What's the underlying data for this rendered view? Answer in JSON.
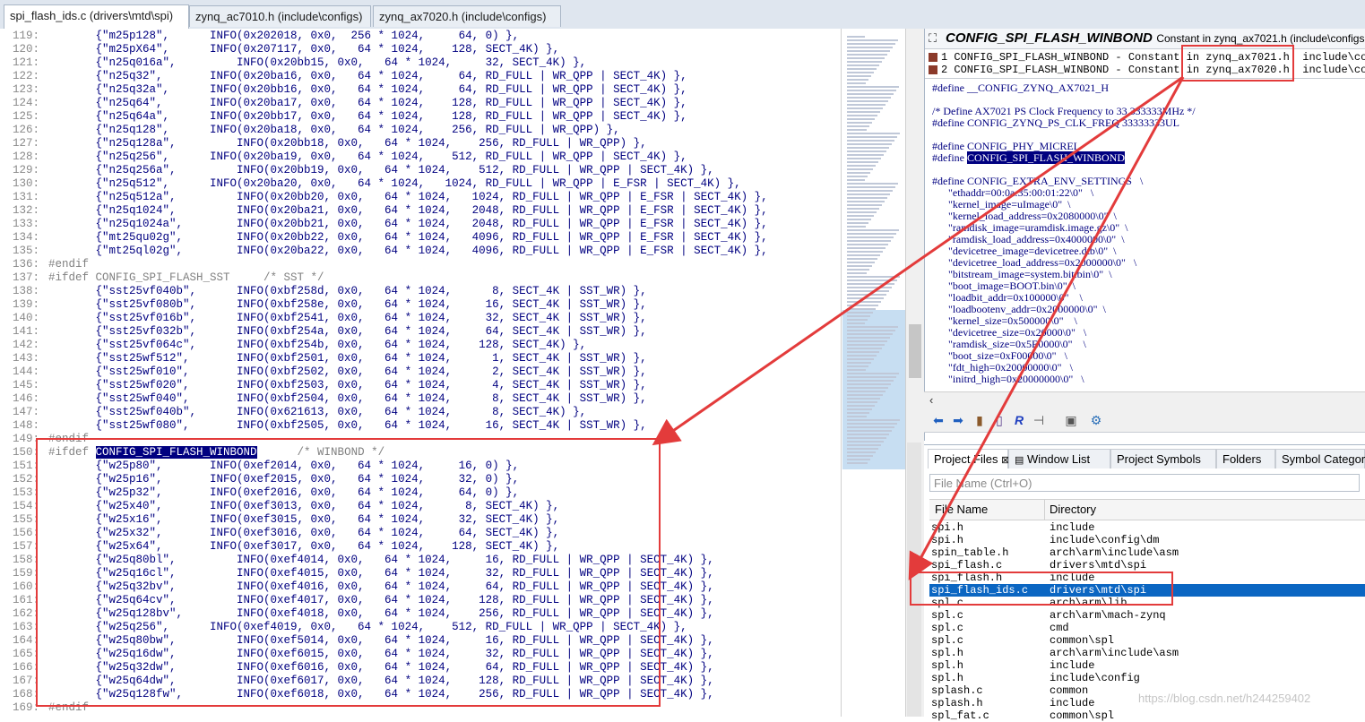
{
  "tabs": [
    {
      "label": "spi_flash_ids.c (drivers\\mtd\\spi)",
      "close": "⊠",
      "active": true
    },
    {
      "label": "zynq_ac7010.h (include\\configs)",
      "active": false
    },
    {
      "label": "zynq_ax7020.h (include\\configs)",
      "active": false
    }
  ],
  "code_lines": [
    {
      "n": "119:",
      "t": "       {\"m25p128\",      INFO(0x202018, 0x0,  256 * 1024,     64, 0) },"
    },
    {
      "n": "120:",
      "t": "       {\"m25pX64\",      INFO(0x207117, 0x0,   64 * 1024,    128, SECT_4K) },"
    },
    {
      "n": "121:",
      "t": "       {\"n25q016a\",         INFO(0x20bb15, 0x0,   64 * 1024,     32, SECT_4K) },"
    },
    {
      "n": "122:",
      "t": "       {\"n25q32\",       INFO(0x20ba16, 0x0,   64 * 1024,     64, RD_FULL | WR_QPP | SECT_4K) },"
    },
    {
      "n": "123:",
      "t": "       {\"n25q32a\",      INFO(0x20bb16, 0x0,   64 * 1024,     64, RD_FULL | WR_QPP | SECT_4K) },"
    },
    {
      "n": "124:",
      "t": "       {\"n25q64\",       INFO(0x20ba17, 0x0,   64 * 1024,    128, RD_FULL | WR_QPP | SECT_4K) },"
    },
    {
      "n": "125:",
      "t": "       {\"n25q64a\",      INFO(0x20bb17, 0x0,   64 * 1024,    128, RD_FULL | WR_QPP | SECT_4K) },"
    },
    {
      "n": "126:",
      "t": "       {\"n25q128\",      INFO(0x20ba18, 0x0,   64 * 1024,    256, RD_FULL | WR_QPP) },"
    },
    {
      "n": "127:",
      "t": "       {\"n25q128a\",         INFO(0x20bb18, 0x0,   64 * 1024,    256, RD_FULL | WR_QPP) },"
    },
    {
      "n": "128:",
      "t": "       {\"n25q256\",      INFO(0x20ba19, 0x0,   64 * 1024,    512, RD_FULL | WR_QPP | SECT_4K) },"
    },
    {
      "n": "129:",
      "t": "       {\"n25q256a\",         INFO(0x20bb19, 0x0,   64 * 1024,    512, RD_FULL | WR_QPP | SECT_4K) },"
    },
    {
      "n": "130:",
      "t": "       {\"n25q512\",      INFO(0x20ba20, 0x0,   64 * 1024,   1024, RD_FULL | WR_QPP | E_FSR | SECT_4K) },"
    },
    {
      "n": "131:",
      "t": "       {\"n25q512a\",         INFO(0x20bb20, 0x0,   64 * 1024,   1024, RD_FULL | WR_QPP | E_FSR | SECT_4K) },"
    },
    {
      "n": "132:",
      "t": "       {\"n25q1024\",         INFO(0x20ba21, 0x0,   64 * 1024,   2048, RD_FULL | WR_QPP | E_FSR | SECT_4K) },"
    },
    {
      "n": "133:",
      "t": "       {\"n25q1024a\",        INFO(0x20bb21, 0x0,   64 * 1024,   2048, RD_FULL | WR_QPP | E_FSR | SECT_4K) },"
    },
    {
      "n": "134:",
      "t": "       {\"mt25qu02g\",        INFO(0x20bb22, 0x0,   64 * 1024,   4096, RD_FULL | WR_QPP | E_FSR | SECT_4K) },"
    },
    {
      "n": "135:",
      "t": "       {\"mt25ql02g\",        INFO(0x20ba22, 0x0,   64 * 1024,   4096, RD_FULL | WR_QPP | E_FSR | SECT_4K) },"
    },
    {
      "n": "136:",
      "t": "#endif"
    },
    {
      "n": "137:",
      "t": "#ifdef CONFIG_SPI_FLASH_SST     /* SST */"
    },
    {
      "n": "138:",
      "t": "       {\"sst25vf040b\",      INFO(0xbf258d, 0x0,   64 * 1024,      8, SECT_4K | SST_WR) },"
    },
    {
      "n": "139:",
      "t": "       {\"sst25vf080b\",      INFO(0xbf258e, 0x0,   64 * 1024,     16, SECT_4K | SST_WR) },"
    },
    {
      "n": "140:",
      "t": "       {\"sst25vf016b\",      INFO(0xbf2541, 0x0,   64 * 1024,     32, SECT_4K | SST_WR) },"
    },
    {
      "n": "141:",
      "t": "       {\"sst25vf032b\",      INFO(0xbf254a, 0x0,   64 * 1024,     64, SECT_4K | SST_WR) },"
    },
    {
      "n": "142:",
      "t": "       {\"sst25vf064c\",      INFO(0xbf254b, 0x0,   64 * 1024,    128, SECT_4K) },"
    },
    {
      "n": "143:",
      "t": "       {\"sst25wf512\",       INFO(0xbf2501, 0x0,   64 * 1024,      1, SECT_4K | SST_WR) },"
    },
    {
      "n": "144:",
      "t": "       {\"sst25wf010\",       INFO(0xbf2502, 0x0,   64 * 1024,      2, SECT_4K | SST_WR) },"
    },
    {
      "n": "145:",
      "t": "       {\"sst25wf020\",       INFO(0xbf2503, 0x0,   64 * 1024,      4, SECT_4K | SST_WR) },"
    },
    {
      "n": "146:",
      "t": "       {\"sst25wf040\",       INFO(0xbf2504, 0x0,   64 * 1024,      8, SECT_4K | SST_WR) },"
    },
    {
      "n": "147:",
      "t": "       {\"sst25wf040b\",      INFO(0x621613, 0x0,   64 * 1024,      8, SECT_4K) },"
    },
    {
      "n": "148:",
      "t": "       {\"sst25wf080\",       INFO(0xbf2505, 0x0,   64 * 1024,     16, SECT_4K | SST_WR) },"
    },
    {
      "n": "149:",
      "t": "#endif"
    },
    {
      "n": "150:",
      "t": "#ifdef CONFIG_SPI_FLASH_WINBOND      /* WINBOND */",
      "sel": "CONFIG_SPI_FLASH_WINBOND"
    },
    {
      "n": "151:",
      "t": "       {\"w25p80\",       INFO(0xef2014, 0x0,   64 * 1024,     16, 0) },"
    },
    {
      "n": "152:",
      "t": "       {\"w25p16\",       INFO(0xef2015, 0x0,   64 * 1024,     32, 0) },"
    },
    {
      "n": "153:",
      "t": "       {\"w25p32\",       INFO(0xef2016, 0x0,   64 * 1024,     64, 0) },"
    },
    {
      "n": "154:",
      "t": "       {\"w25x40\",       INFO(0xef3013, 0x0,   64 * 1024,      8, SECT_4K) },"
    },
    {
      "n": "155:",
      "t": "       {\"w25x16\",       INFO(0xef3015, 0x0,   64 * 1024,     32, SECT_4K) },"
    },
    {
      "n": "156:",
      "t": "       {\"w25x32\",       INFO(0xef3016, 0x0,   64 * 1024,     64, SECT_4K) },"
    },
    {
      "n": "157:",
      "t": "       {\"w25x64\",       INFO(0xef3017, 0x0,   64 * 1024,    128, SECT_4K) },"
    },
    {
      "n": "158:",
      "t": "       {\"w25q80bl\",         INFO(0xef4014, 0x0,   64 * 1024,     16, RD_FULL | WR_QPP | SECT_4K) },"
    },
    {
      "n": "159:",
      "t": "       {\"w25q16cl\",         INFO(0xef4015, 0x0,   64 * 1024,     32, RD_FULL | WR_QPP | SECT_4K) },"
    },
    {
      "n": "160:",
      "t": "       {\"w25q32bv\",         INFO(0xef4016, 0x0,   64 * 1024,     64, RD_FULL | WR_QPP | SECT_4K) },"
    },
    {
      "n": "161:",
      "t": "       {\"w25q64cv\",         INFO(0xef4017, 0x0,   64 * 1024,    128, RD_FULL | WR_QPP | SECT_4K) },"
    },
    {
      "n": "162:",
      "t": "       {\"w25q128bv\",        INFO(0xef4018, 0x0,   64 * 1024,    256, RD_FULL | WR_QPP | SECT_4K) },"
    },
    {
      "n": "163:",
      "t": "       {\"w25q256\",      INFO(0xef4019, 0x0,   64 * 1024,    512, RD_FULL | WR_QPP | SECT_4K) },"
    },
    {
      "n": "164:",
      "t": "       {\"w25q80bw\",         INFO(0xef5014, 0x0,   64 * 1024,     16, RD_FULL | WR_QPP | SECT_4K) },"
    },
    {
      "n": "165:",
      "t": "       {\"w25q16dw\",         INFO(0xef6015, 0x0,   64 * 1024,     32, RD_FULL | WR_QPP | SECT_4K) },"
    },
    {
      "n": "166:",
      "t": "       {\"w25q32dw\",         INFO(0xef6016, 0x0,   64 * 1024,     64, RD_FULL | WR_QPP | SECT_4K) },"
    },
    {
      "n": "167:",
      "t": "       {\"w25q64dw\",         INFO(0xef6017, 0x0,   64 * 1024,    128, RD_FULL | WR_QPP | SECT_4K) },"
    },
    {
      "n": "168:",
      "t": "       {\"w25q128fw\",        INFO(0xef6018, 0x0,   64 * 1024,    256, RD_FULL | WR_QPP | SECT_4K) },"
    },
    {
      "n": "169:",
      "t": "#endif"
    }
  ],
  "symbol": {
    "title": "CONFIG_SPI_FLASH_WINBOND",
    "subtitle": "Constant in zynq_ax7021.h (include\\configs",
    "defs": [
      {
        "n": "1",
        "text": "CONFIG_SPI_FLASH_WINBOND - Constant in zynq_ax7021.h  include\\con"
      },
      {
        "n": "2",
        "text": "CONFIG_SPI_FLASH_WINBOND - Constant in zynq_ax7020.h  include\\con"
      }
    ],
    "source": [
      "#define __CONFIG_ZYNQ_AX7021_H",
      "",
      "/* Define AX7021 PS Clock Frequency to 33.333333MHz */",
      "#define CONFIG_ZYNQ_PS_CLK_FREQ 33333333UL",
      "",
      "#define CONFIG_PHY_MICREL",
      "#define CONFIG_SPI_FLASH_WINBOND",
      "",
      "#define CONFIG_EXTRA_ENV_SETTINGS   \\",
      "      \"ethaddr=00:0a:35:00:01:22\\0\"   \\",
      "      \"kernel_image=uImage\\0\"  \\",
      "      \"kernel_load_address=0x2080000\\0\"  \\",
      "      \"ramdisk_image=uramdisk.image.gz\\0\"  \\",
      "      \"ramdisk_load_address=0x4000000\\0\"  \\",
      "      \"devicetree_image=devicetree.dtb\\0\"  \\",
      "      \"devicetree_load_address=0x2000000\\0\"   \\",
      "      \"bitstream_image=system.bit.bin\\0\"  \\",
      "      \"boot_image=BOOT.bin\\0\"  \\",
      "      \"loadbit_addr=0x100000\\0\"    \\",
      "      \"loadbootenv_addr=0x2000000\\0\"  \\",
      "      \"kernel_size=0x500000\\0\"    \\",
      "      \"devicetree_size=0x20000\\0\"   \\",
      "      \"ramdisk_size=0x5E0000\\0\"    \\",
      "      \"boot_size=0xF00000\\0\"   \\",
      "      \"fdt_high=0x20000000\\0\"   \\",
      "      \"initrd_high=0x20000000\\0\"   \\"
    ],
    "selected": "CONFIG_SPI_FLASH_WINBOND"
  },
  "project": {
    "tabs": [
      "Project Files",
      "Window List",
      "Project Symbols",
      "Folders",
      "Symbol Categor"
    ],
    "filter_placeholder": "File Name (Ctrl+O)",
    "col_file": "File Name",
    "col_dir": "Directory",
    "files": [
      {
        "name": "spi.h",
        "dir": "include"
      },
      {
        "name": "spi.h",
        "dir": "include\\config\\dm"
      },
      {
        "name": "spin_table.h",
        "dir": "arch\\arm\\include\\asm"
      },
      {
        "name": "spi_flash.c",
        "dir": "drivers\\mtd\\spi"
      },
      {
        "name": "spi_flash.h",
        "dir": "include"
      },
      {
        "name": "spi_flash_ids.c",
        "dir": "drivers\\mtd\\spi",
        "selected": true
      },
      {
        "name": "spl.c",
        "dir": "arch\\arm\\lib"
      },
      {
        "name": "spl.c",
        "dir": "arch\\arm\\mach-zynq"
      },
      {
        "name": "spl.c",
        "dir": "cmd"
      },
      {
        "name": "spl.c",
        "dir": "common\\spl"
      },
      {
        "name": "spl.h",
        "dir": "arch\\arm\\include\\asm"
      },
      {
        "name": "spl.h",
        "dir": "include"
      },
      {
        "name": "spl.h",
        "dir": "include\\config"
      },
      {
        "name": "splash.c",
        "dir": "common"
      },
      {
        "name": "splash.h",
        "dir": "include"
      },
      {
        "name": "spl_fat.c",
        "dir": "common\\spl"
      }
    ]
  },
  "watermark": "https://blog.csdn.net/h244259402",
  "colors": {
    "annotation": "#e33b3b",
    "selection": "#000080",
    "file_selected": "#0b66c2"
  }
}
